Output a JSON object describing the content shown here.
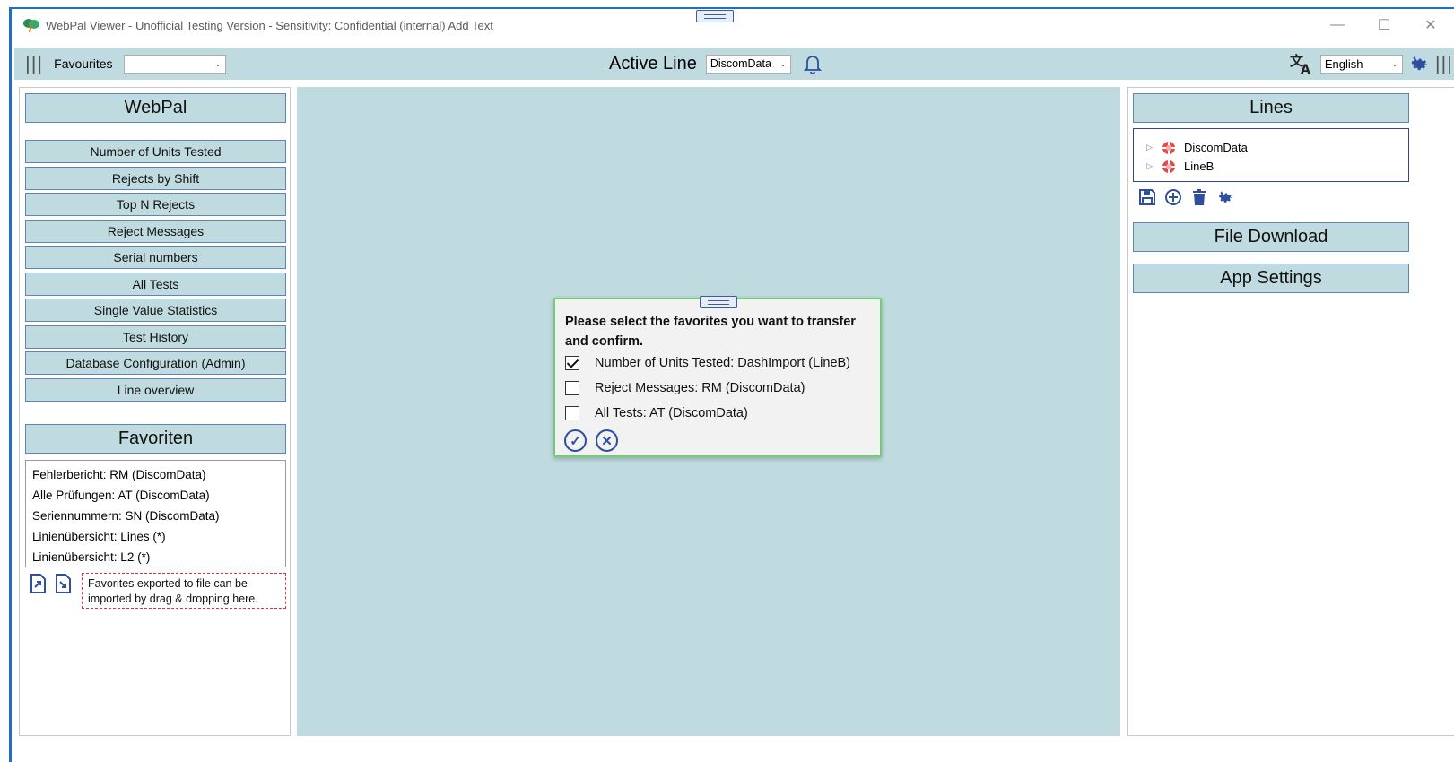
{
  "window": {
    "title": "WebPal Viewer - Unofficial Testing Version - Sensitivity: Confidential (internal) Add Text",
    "controls": {
      "minimize": "—",
      "maximize": "☐",
      "close": "✕"
    }
  },
  "toolbar": {
    "favourites_label": "Favourites",
    "favourites_value": "",
    "active_line_label": "Active Line",
    "active_line_value": "DiscomData",
    "language_value": "English",
    "icons": [
      "bell-icon",
      "translate-icon",
      "gear-icon"
    ]
  },
  "left": {
    "header": "WebPal",
    "nav_items": [
      "Number of Units Tested",
      "Rejects by Shift",
      "Top N Rejects",
      "Reject Messages",
      "Serial numbers",
      "All Tests",
      "Single Value Statistics",
      "Test History",
      "Database Configuration (Admin)",
      "Line overview"
    ],
    "favorites_header": "Favoriten",
    "favorites": [
      "Fehlerbericht: RM (DiscomData)",
      "Alle Prüfungen: AT (DiscomData)",
      "Seriennummern: SN (DiscomData)",
      "Linienübersicht: Lines (*)",
      "Linienübersicht: L2 (*)"
    ],
    "drop_hint": "Favorites exported to file can be imported by drag & dropping here."
  },
  "right": {
    "lines_header": "Lines",
    "lines": [
      "DiscomData",
      "LineB"
    ],
    "file_download": "File Download",
    "app_settings": "App Settings"
  },
  "dialog": {
    "title": "Please select the favorites you want to transfer and confirm.",
    "options": [
      {
        "label": "Number of Units Tested: DashImport (LineB)",
        "checked": true
      },
      {
        "label": "Reject Messages: RM (DiscomData)",
        "checked": false
      },
      {
        "label": "All Tests: AT (DiscomData)",
        "checked": false
      }
    ],
    "confirm_glyph": "✓",
    "cancel_glyph": "✕"
  },
  "colors": {
    "panel_bg": "#c0dbe0",
    "button_border": "#5f84b5",
    "accent_blue": "#2f4ea0",
    "dialog_border": "#6dd26d",
    "drop_border": "#e03030"
  }
}
